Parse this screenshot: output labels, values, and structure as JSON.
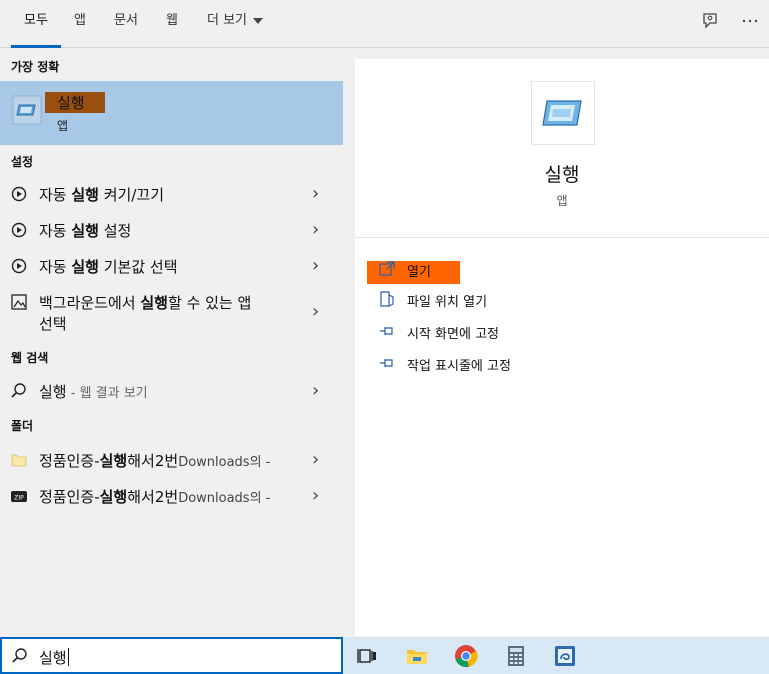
{
  "tabs": [
    {
      "label": "모두",
      "active": true
    },
    {
      "label": "앱"
    },
    {
      "label": "문서"
    },
    {
      "label": "웹"
    },
    {
      "label": "더 보기"
    }
  ],
  "top_icons": [
    "feedback-icon",
    "more-options-icon"
  ],
  "sections": {
    "best_match": "가장 정확",
    "settings": "설정",
    "web_search": "웹 검색",
    "folders": "폴더"
  },
  "best_match": {
    "title": "실행",
    "subtitle": "앱",
    "icon": "run-app-icon",
    "highlight_color": "#9a4f0f"
  },
  "settings_items": [
    {
      "pre": "자동 ",
      "bold": "실행",
      "post": " 켜기/끄기",
      "icon": "settings-circle-arrow-icon"
    },
    {
      "pre": "자동 ",
      "bold": "실행",
      "post": " 설정",
      "icon": "settings-circle-arrow-icon"
    },
    {
      "pre": "자동 ",
      "bold": "실행",
      "post": " 기본값 선택",
      "icon": "settings-circle-arrow-icon"
    },
    {
      "pre": "백그라운드에서 ",
      "bold": "실행",
      "post": "할 수 있는 앱",
      "line2": "선택",
      "icon": "image-edit-icon"
    }
  ],
  "web_item": {
    "bold": "실행",
    "suffix": " - 웹 결과 보기",
    "icon": "search-icon"
  },
  "folder_items": [
    {
      "pre": "정품인증-",
      "bold": "실행",
      "post": "해서2번",
      "suffix": "Downloads의 -",
      "icon": "folder-icon"
    },
    {
      "pre": "정품인증-",
      "bold": "실행",
      "post": "해서2번",
      "suffix": "Downloads의 -",
      "icon": "zip-icon"
    }
  ],
  "preview": {
    "title": "실행",
    "subtitle": "앱",
    "actions": [
      {
        "label": "열기",
        "icon": "open-icon"
      },
      {
        "label": "파일 위치 열기",
        "icon": "file-location-icon"
      },
      {
        "label": "시작 화면에 고정",
        "icon": "pin-icon"
      },
      {
        "label": "작업 표시줄에 고정",
        "icon": "pin-icon"
      }
    ],
    "open_highlight_color": "#ff6600"
  },
  "search": {
    "value": "실행"
  },
  "taskbar_icons": [
    "task-view-icon",
    "file-explorer-icon",
    "chrome-icon",
    "calculator-icon",
    "app-icon"
  ],
  "colors": {
    "accent": "#0067c0",
    "selected_bg": "#a8c8e8",
    "taskbar_bg": "#d8e8f4"
  }
}
